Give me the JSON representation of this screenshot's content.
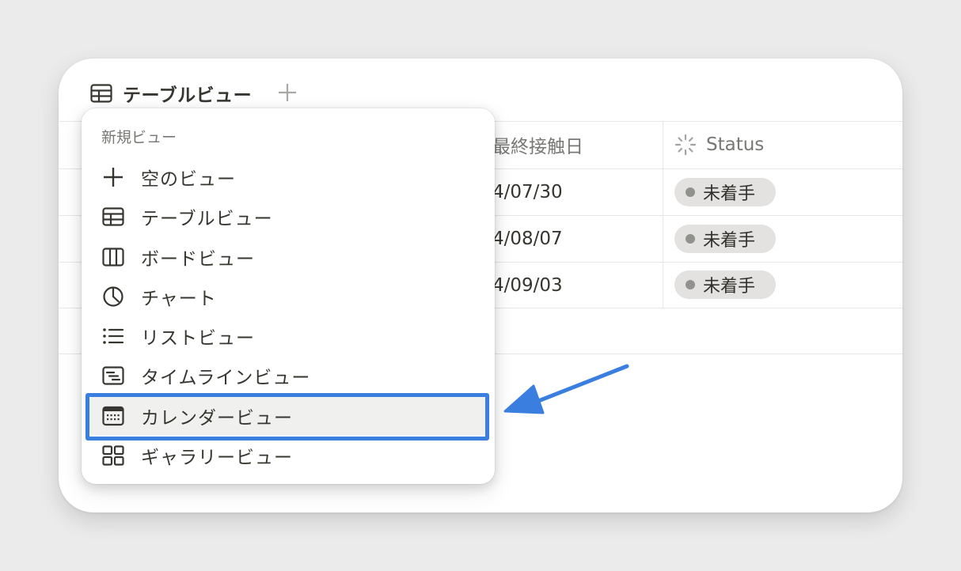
{
  "header": {
    "view_name": "テーブルビュー",
    "tools": [
      "filter-icon",
      "sort-icon",
      "automation-icon",
      "search-icon"
    ],
    "accent_color": "#2f80d9"
  },
  "table": {
    "columns": [
      {
        "label": "最終接触日",
        "icon": ""
      },
      {
        "label": "Status",
        "icon": "status-icon"
      }
    ],
    "rows": [
      {
        "date": "4/07/30",
        "status": "未着手"
      },
      {
        "date": "4/08/07",
        "status": "未着手"
      },
      {
        "date": "4/09/03",
        "status": "未着手"
      }
    ]
  },
  "menu": {
    "heading": "新規ビュー",
    "items": [
      {
        "label": "空のビュー",
        "icon": "plus-icon"
      },
      {
        "label": "テーブルビュー",
        "icon": "table-icon"
      },
      {
        "label": "ボードビュー",
        "icon": "board-icon"
      },
      {
        "label": "チャート",
        "icon": "chart-icon"
      },
      {
        "label": "リストビュー",
        "icon": "list-icon"
      },
      {
        "label": "タイムラインビュー",
        "icon": "timeline-icon"
      },
      {
        "label": "カレンダービュー",
        "icon": "calendar-icon"
      },
      {
        "label": "ギャラリービュー",
        "icon": "gallery-icon"
      }
    ],
    "highlighted_item": "カレンダービュー",
    "annotation_color": "#3a7fe0"
  }
}
